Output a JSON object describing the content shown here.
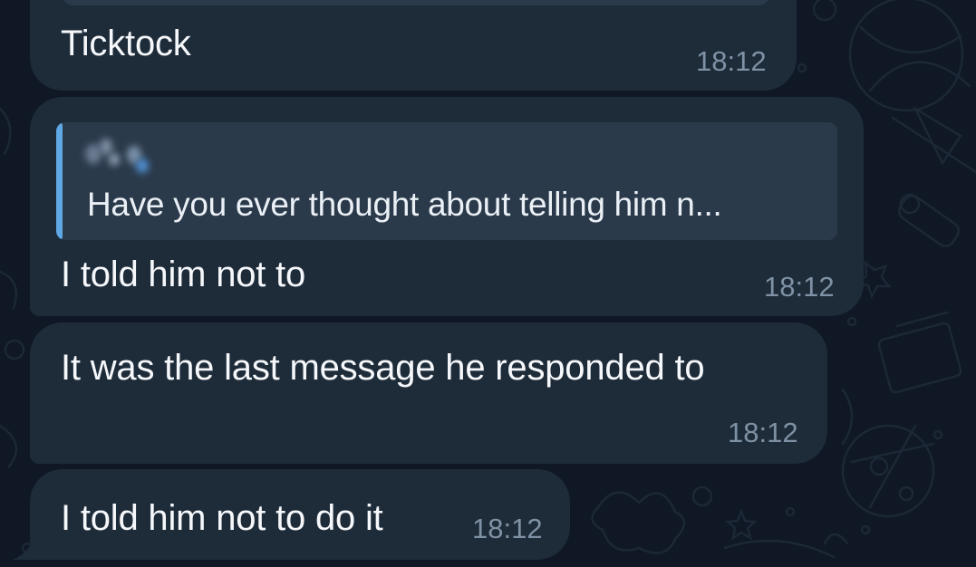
{
  "colors": {
    "background": "#0f1824",
    "bubble": "#1e2c3a",
    "reply_box": "#2b3a4b",
    "reply_accent": "#5fa8e6",
    "time_text": "#7f91a4",
    "message_text": "#f5f7fa"
  },
  "messages": [
    {
      "text": "Ticktock",
      "time": "18:12"
    },
    {
      "reply": {
        "snippet": "Have you ever thought about telling him n..."
      },
      "text": "I told him not to",
      "time": "18:12"
    },
    {
      "text": "It was the last message he responded to",
      "time": "18:12"
    },
    {
      "text": "I told him not to do it",
      "time": "18:12"
    }
  ]
}
